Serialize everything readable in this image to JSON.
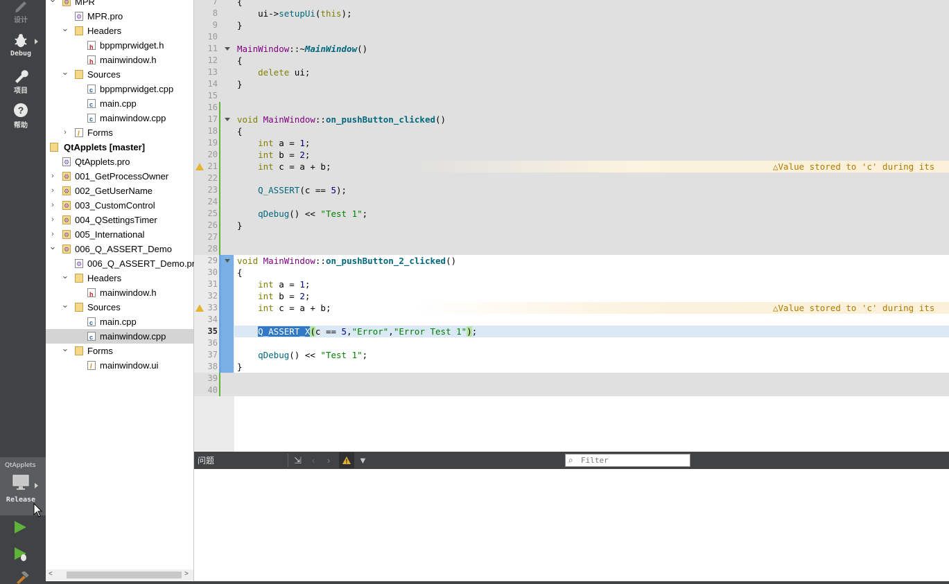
{
  "modebar": {
    "items": [
      {
        "name": "design",
        "label": "设计"
      },
      {
        "name": "debug",
        "label": "Debug"
      },
      {
        "name": "project",
        "label": "项目"
      },
      {
        "name": "help",
        "label": "帮助"
      }
    ],
    "kit": {
      "project": "QtApplets",
      "build": "Release"
    }
  },
  "tree": {
    "rows": [
      {
        "label": "MPR",
        "depth": 0,
        "icon": "gear-folder",
        "expand": "open"
      },
      {
        "label": "MPR.pro",
        "depth": 1,
        "icon": "pro",
        "expand": "none"
      },
      {
        "label": "Headers",
        "depth": 1,
        "icon": "folder",
        "expand": "open"
      },
      {
        "label": "bppmprwidget.h",
        "depth": 2,
        "icon": "h",
        "expand": "none"
      },
      {
        "label": "mainwindow.h",
        "depth": 2,
        "icon": "h",
        "expand": "none"
      },
      {
        "label": "Sources",
        "depth": 1,
        "icon": "folder",
        "expand": "open"
      },
      {
        "label": "bppmprwidget.cpp",
        "depth": 2,
        "icon": "cpp",
        "expand": "none"
      },
      {
        "label": "main.cpp",
        "depth": 2,
        "icon": "cpp",
        "expand": "none"
      },
      {
        "label": "mainwindow.cpp",
        "depth": 2,
        "icon": "cpp",
        "expand": "none"
      },
      {
        "label": "Forms",
        "depth": 1,
        "icon": "ui",
        "expand": "closed"
      },
      {
        "label": "QtApplets [master]",
        "depth": -1,
        "icon": "folder",
        "expand": "none",
        "bold": true
      },
      {
        "label": "QtApplets.pro",
        "depth": 0,
        "icon": "pro",
        "expand": "none"
      },
      {
        "label": "001_GetProcessOwner",
        "depth": 0,
        "icon": "gear-folder",
        "expand": "closed"
      },
      {
        "label": "002_GetUserName",
        "depth": 0,
        "icon": "gear-folder",
        "expand": "closed"
      },
      {
        "label": "003_CustomControl",
        "depth": 0,
        "icon": "gear-folder",
        "expand": "closed"
      },
      {
        "label": "004_QSettingsTimer",
        "depth": 0,
        "icon": "gear-folder",
        "expand": "closed"
      },
      {
        "label": "005_International",
        "depth": 0,
        "icon": "gear-folder",
        "expand": "closed"
      },
      {
        "label": "006_Q_ASSERT_Demo",
        "depth": 0,
        "icon": "gear-folder",
        "expand": "open"
      },
      {
        "label": "006_Q_ASSERT_Demo.pro",
        "depth": 1,
        "icon": "pro",
        "expand": "none"
      },
      {
        "label": "Headers",
        "depth": 1,
        "icon": "folder",
        "expand": "open"
      },
      {
        "label": "mainwindow.h",
        "depth": 2,
        "icon": "h",
        "expand": "none"
      },
      {
        "label": "Sources",
        "depth": 1,
        "icon": "folder",
        "expand": "open"
      },
      {
        "label": "main.cpp",
        "depth": 2,
        "icon": "cpp",
        "expand": "none"
      },
      {
        "label": "mainwindow.cpp",
        "depth": 2,
        "icon": "cpp",
        "expand": "none",
        "selected": true
      },
      {
        "label": "Forms",
        "depth": 1,
        "icon": "folder",
        "expand": "open"
      },
      {
        "label": "mainwindow.ui",
        "depth": 2,
        "icon": "ui",
        "expand": "none"
      }
    ]
  },
  "editor": {
    "current_line": 35,
    "lines": [
      {
        "n": 7,
        "html": "{"
      },
      {
        "n": 8,
        "html": "    ui-&gt;<span class='fn'>setupUi</span>(<span class='kw'>this</span>);"
      },
      {
        "n": 9,
        "html": "}"
      },
      {
        "n": 10,
        "html": ""
      },
      {
        "n": 11,
        "html": "<span class='ty'>MainWindow</span>::~<span class='it'>MainWindow</span>()"
      },
      {
        "n": 12,
        "html": "{"
      },
      {
        "n": 13,
        "html": "    <span class='kw'>delete</span> ui;"
      },
      {
        "n": 14,
        "html": "}"
      },
      {
        "n": 15,
        "html": ""
      },
      {
        "n": 16,
        "html": ""
      },
      {
        "n": 17,
        "html": "<span class='kw'>void</span> <span class='ty'>MainWindow</span>::<span class='fnb'>on_pushButton_clicked</span>()"
      },
      {
        "n": 18,
        "html": "{"
      },
      {
        "n": 19,
        "html": "    <span class='kw'>int</span> a = <span class='num'>1</span>;"
      },
      {
        "n": 20,
        "html": "    <span class='kw'>int</span> b = <span class='num'>2</span>;"
      },
      {
        "n": 21,
        "html": "    <span class='kw'>int</span> c = a + b;"
      },
      {
        "n": 22,
        "html": ""
      },
      {
        "n": 23,
        "html": "    <span class='fn'>Q_ASSERT</span>(c == <span class='num'>5</span>);"
      },
      {
        "n": 24,
        "html": ""
      },
      {
        "n": 25,
        "html": "    <span class='fn'>qDebug</span>() &lt;&lt; <span class='str'>\"Test 1\"</span>;"
      },
      {
        "n": 26,
        "html": "}"
      },
      {
        "n": 27,
        "html": ""
      },
      {
        "n": 28,
        "html": ""
      },
      {
        "n": 29,
        "html": "<span class='kw'>void</span> <span class='ty'>MainWindow</span>::<span class='fnb'>on_pushButton_2_clicked</span>()"
      },
      {
        "n": 30,
        "html": "{"
      },
      {
        "n": 31,
        "html": "    <span class='kw'>int</span> a = <span class='num'>1</span>;"
      },
      {
        "n": 32,
        "html": "    <span class='kw'>int</span> b = <span class='num'>2</span>;"
      },
      {
        "n": 33,
        "html": "    <span class='kw'>int</span> c = a + b;"
      },
      {
        "n": 34,
        "html": ""
      },
      {
        "n": 35,
        "html": "    <span style='background:#3178c6;color:#fff'>Q_ASSERT_X</span><span style='background:#b4e6a0'>(</span>c == <span class='num'>5</span>,<span class='str'>\"Error\"</span>,<span class='str'>\"Error Test 1\"</span><span style='background:#b4e6a0'>)</span>;"
      },
      {
        "n": 36,
        "html": ""
      },
      {
        "n": 37,
        "html": "    <span class='fn'>qDebug</span>() &lt;&lt; <span class='str'>\"Test 1\"</span>;"
      },
      {
        "n": 38,
        "html": "}"
      },
      {
        "n": 39,
        "html": ""
      },
      {
        "n": 40,
        "html": ""
      }
    ],
    "warning_lines": [
      21,
      33
    ],
    "warning_text": "Value stored to 'c' during its",
    "fold_lines": [
      11,
      17,
      29
    ]
  },
  "issues": {
    "title": "问题",
    "filter_placeholder": "Filter"
  },
  "colors": {
    "modebar_bg": "#404244",
    "selection": "#3178c6",
    "current_line": "#dbe9f7",
    "warning": "#e5b333"
  }
}
